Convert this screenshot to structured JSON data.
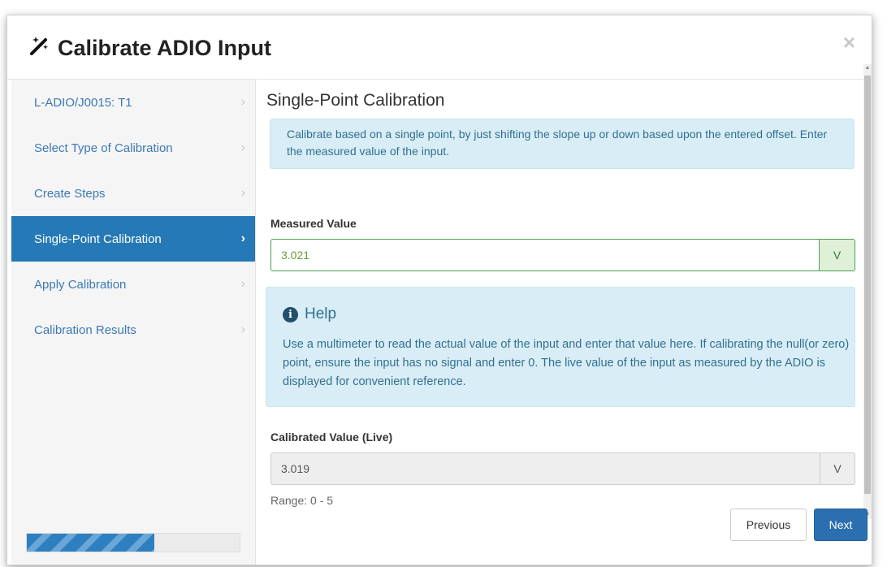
{
  "modal": {
    "title": "Calibrate ADIO Input",
    "title_icon": "magic-wand-icon",
    "close_glyph": "×"
  },
  "sidebar": {
    "items": [
      {
        "label": "L-ADIO/J0015: T1",
        "active": false
      },
      {
        "label": "Select Type of Calibration",
        "active": false
      },
      {
        "label": "Create Steps",
        "active": false
      },
      {
        "label": "Single-Point Calibration",
        "active": true
      },
      {
        "label": "Apply Calibration",
        "active": false
      },
      {
        "label": "Calibration Results",
        "active": false
      }
    ],
    "chevron": "›",
    "progress_fraction": 0.6
  },
  "content": {
    "section_title": "Single-Point Calibration",
    "info_text": "Calibrate based on a single point, by just shifting the slope up or down based upon the entered offset. Enter the measured value of the input.",
    "measured": {
      "label": "Measured Value",
      "value": "3.021",
      "unit": "V"
    },
    "help": {
      "title": "Help",
      "icon": "info-circle-icon",
      "text": "Use a multimeter to read the actual value of the input and enter that value here. If calibrating the null(or zero) point, ensure the input has no signal and enter 0. The live value of the input as measured by the ADIO is displayed for convenient reference."
    },
    "calibrated": {
      "label": "Calibrated Value (Live)",
      "value": "3.019",
      "unit": "V"
    },
    "range": "Range: 0 - 5"
  },
  "buttons": {
    "previous": "Previous",
    "next": "Next"
  },
  "colors": {
    "accent": "#2579b6",
    "info_bg": "#d9edf7",
    "info_text": "#31708f",
    "success_border": "#4ea04e"
  }
}
